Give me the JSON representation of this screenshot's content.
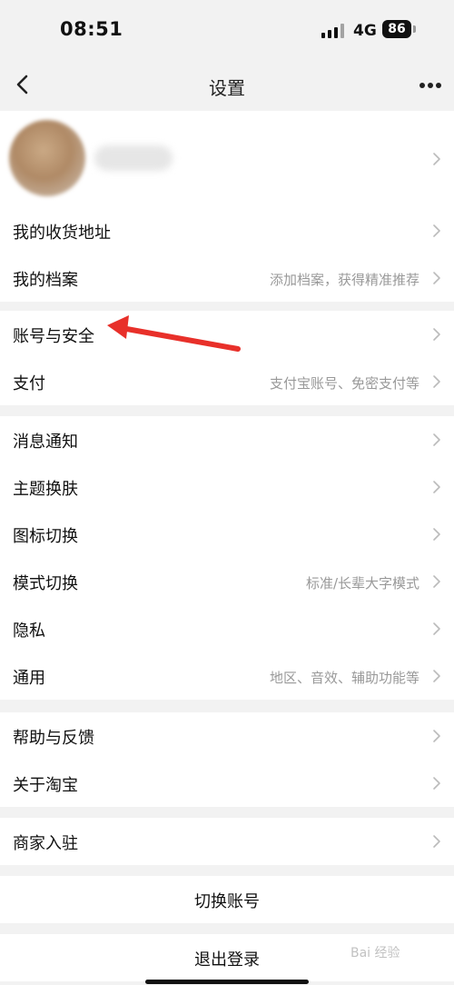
{
  "status_bar": {
    "time": "08:51",
    "network": "4G",
    "battery": "86"
  },
  "header": {
    "title": "设置"
  },
  "groups": {
    "profile": {
      "address": "我的收货地址",
      "archive": "我的档案",
      "archive_hint": "添加档案，获得精准推荐"
    },
    "account": {
      "security": "账号与安全",
      "pay": "支付",
      "pay_hint": "支付宝账号、免密支付等"
    },
    "preferences": {
      "notify": "消息通知",
      "theme": "主题换肤",
      "icon": "图标切换",
      "mode": "模式切换",
      "mode_hint": "标准/长辈大字模式",
      "privacy": "隐私",
      "general": "通用",
      "general_hint": "地区、音效、辅助功能等"
    },
    "help": {
      "feedback": "帮助与反馈",
      "about": "关于淘宝"
    },
    "merchant": {
      "join": "商家入驻"
    }
  },
  "actions": {
    "switch_account": "切换账号",
    "logout": "退出登录"
  },
  "watermark": "Bai 经验",
  "annotation": {
    "arrow_color": "#e8302a",
    "arrow_target": "账号与安全"
  },
  "colors": {
    "background": "#f2f2f2",
    "card": "#ffffff",
    "hint_text": "#999999"
  }
}
